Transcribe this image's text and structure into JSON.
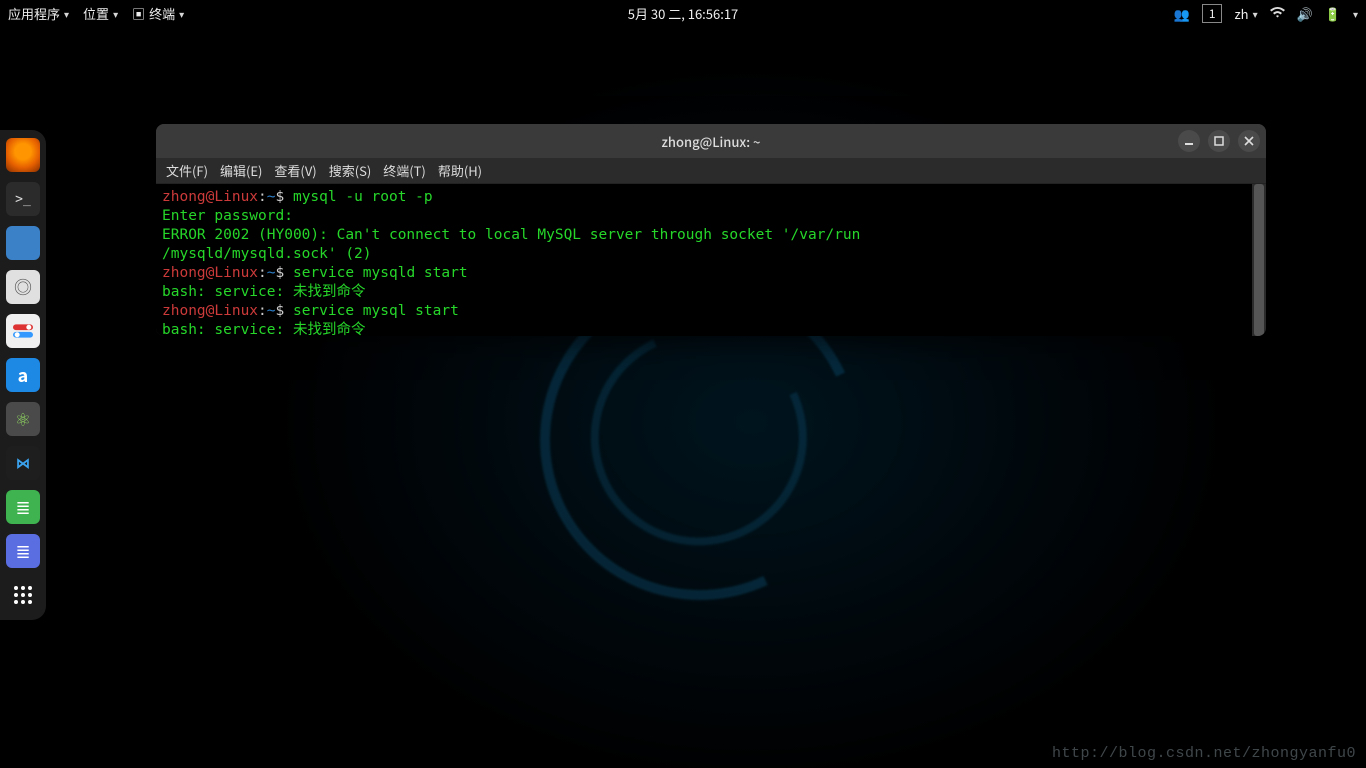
{
  "topbar": {
    "apps_label": "应用程序",
    "places_label": "位置",
    "terminal_indicator": "终端",
    "datetime": "5月 30 二, 16:56:17",
    "workspace": "1",
    "input_method": "zh"
  },
  "dock": {
    "items": [
      {
        "name": "firefox",
        "glyph": "🦊"
      },
      {
        "name": "terminal",
        "glyph": ">_"
      },
      {
        "name": "files",
        "glyph": "📁"
      },
      {
        "name": "settings",
        "glyph": "◎"
      },
      {
        "name": "tweaks",
        "glyph": "⚙"
      },
      {
        "name": "software",
        "glyph": "a"
      },
      {
        "name": "atom",
        "glyph": "⚛"
      },
      {
        "name": "vscode",
        "glyph": "⋈"
      },
      {
        "name": "wps-writer",
        "glyph": "≣"
      },
      {
        "name": "wps-presentation",
        "glyph": "≣"
      }
    ]
  },
  "terminal": {
    "title": "zhong@Linux: ~",
    "menu": {
      "file": "文件(F)",
      "edit": "编辑(E)",
      "view": "查看(V)",
      "search": "搜索(S)",
      "terminal": "终端(T)",
      "help": "帮助(H)"
    },
    "prompt": {
      "user": "zhong@Linux",
      "path": "~",
      "sign": "$"
    },
    "lines": [
      {
        "type": "cmd",
        "text": "mysql -u root -p"
      },
      {
        "type": "out",
        "text": "Enter password: "
      },
      {
        "type": "out",
        "text": "ERROR 2002 (HY000): Can't connect to local MySQL server through socket '/var/run"
      },
      {
        "type": "out",
        "text": "/mysqld/mysqld.sock' (2)"
      },
      {
        "type": "cmd",
        "text": "service mysqld start"
      },
      {
        "type": "out",
        "text": "bash: service: 未找到命令"
      },
      {
        "type": "cmd",
        "text": "service mysql start"
      },
      {
        "type": "out",
        "text": "bash: service: 未找到命令"
      }
    ]
  },
  "watermark": "http://blog.csdn.net/zhongyanfu0"
}
